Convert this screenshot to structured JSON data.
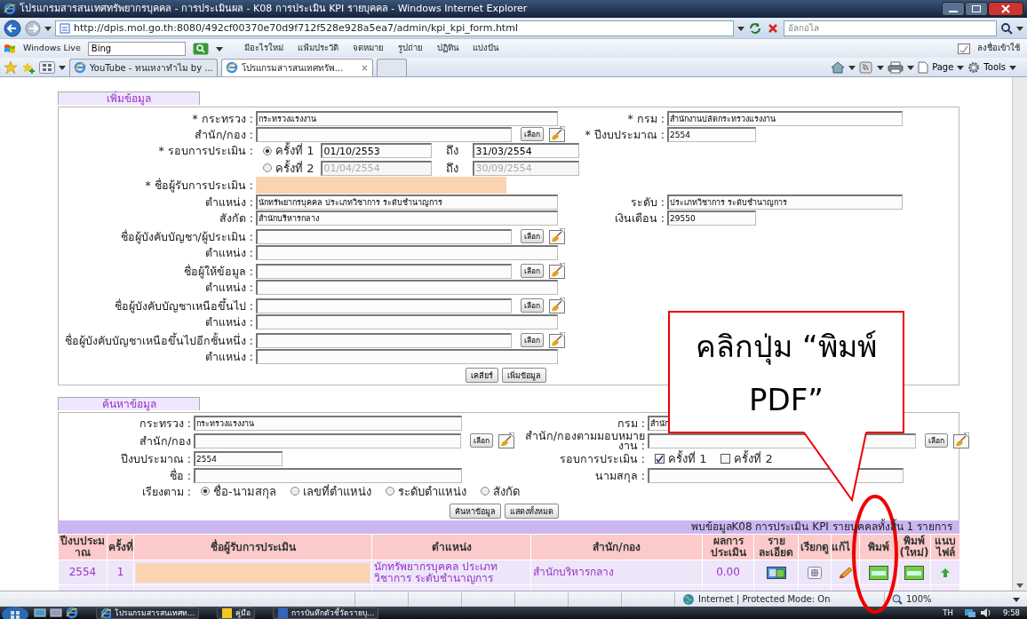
{
  "window": {
    "title": "โปรแกรมสารสนเทศทรัพยากรบุคคล - การประเมินผล - K08 การประเมิน KPI รายบุคคล - Windows Internet Explorer"
  },
  "address_bar": {
    "url": "http://dpis.mol.go.th:8080/492cf00370e70d9f712f528e928a5ea7/admin/kpi_kpi_form.html",
    "search_placeholder": "อัลกอไล"
  },
  "favorites_bar": {
    "brand": "Windows Live",
    "search_value": "Bing",
    "links": [
      "มีอะไรใหม่",
      "แฟ้มประวัติ",
      "จดหมาย",
      "รูปถ่าย",
      "ปฏิทิน",
      "แบ่งปัน"
    ],
    "sign_in": "ลงชื่อเข้าใช้"
  },
  "tabs": [
    {
      "label": "YouTube - ทนเหงาทำไม by ...",
      "selected": false
    },
    {
      "label": "โปรแกรมสารสนเทศทรัพ...",
      "selected": true,
      "close": "×"
    }
  ],
  "command_bar": {
    "page": "Page",
    "tools": "Tools"
  },
  "add_form": {
    "title": "เพิ่มข้อมูล",
    "rows": [
      {
        "left": {
          "kind": "field",
          "label": "* กระทรวง :",
          "value": "กระทรวงแรงงาน"
        },
        "right": {
          "kind": "field",
          "label": "* กรม :",
          "value": "สำนักงานปลัดกระทรวงแรงงาน"
        }
      },
      {
        "left": {
          "kind": "field",
          "label": "สำนัก/กอง :",
          "pick": "เลือก"
        },
        "right": {
          "kind": "short_field",
          "label": "* ปีงบประมาณ :",
          "value": "2554"
        }
      },
      {
        "left": {
          "kind": "round",
          "label": "* รอบการประเมิน :",
          "selected": true,
          "option": "ครั้งที่ 1",
          "from": "01/10/2553",
          "to_label": "ถึง",
          "to": "31/03/2554",
          "disabled": false
        }
      },
      {
        "left": {
          "kind": "round",
          "selected": false,
          "option": "ครั้งที่ 2",
          "from": "01/04/2554",
          "to_label": "ถึง",
          "to": "30/09/2554",
          "disabled": true
        }
      },
      {
        "left": {
          "kind": "masked_field",
          "label": "* ชื่อผู้รับการประเมิน :"
        }
      },
      {
        "left": {
          "kind": "field",
          "label": "ตำแหน่ง :",
          "value": "นักทรัพยากรบุคคล ประเภทวิชาการ ระดับชำนาญการ"
        },
        "right": {
          "kind": "field",
          "label": "ระดับ :",
          "value": "ประเภทวิชาการ ระดับชำนาญการ"
        }
      },
      {
        "left": {
          "kind": "field",
          "label": "สังกัด :",
          "value": "สำนักบริหารกลาง"
        },
        "right": {
          "kind": "short_field",
          "label": "เงินเดือน :",
          "value": "29550"
        }
      },
      {
        "left": {
          "kind": "field",
          "label": "ชื่อผู้บังคับบัญชา/ผู้ประเมิน :",
          "pick": "เลือก"
        }
      },
      {
        "left": {
          "kind": "field",
          "label": "ตำแหน่ง :"
        }
      },
      {
        "left": {
          "kind": "field",
          "label": "ชื่อผู้ให้ข้อมูล :",
          "pick": "เลือก"
        }
      },
      {
        "left": {
          "kind": "field",
          "label": "ตำแหน่ง :"
        }
      },
      {
        "left": {
          "kind": "field",
          "label": "ชื่อผู้บังคับบัญชาเหนือขึ้นไป :",
          "pick": "เลือก"
        }
      },
      {
        "left": {
          "kind": "field",
          "label": "ตำแหน่ง :"
        }
      },
      {
        "left": {
          "kind": "field",
          "label": "ชื่อผู้บังคับบัญชาเหนือขึ้นไปอีกชั้นหนึ่ง :",
          "pick": "เลือก"
        }
      },
      {
        "left": {
          "kind": "field",
          "label": "ตำแหน่ง :"
        }
      }
    ],
    "buttons": [
      "เคลียร์",
      "เพิ่มข้อมูล"
    ]
  },
  "search_form": {
    "title": "ค้นหาข้อมูล",
    "rows": [
      {
        "left": {
          "kind": "field",
          "label": "กระทรวง :",
          "value": "กระทรวงแรงงาน"
        },
        "right": {
          "kind": "field",
          "label": "กรม :",
          "value": "สำนัก"
        }
      },
      {
        "left": {
          "kind": "field",
          "label": "สำนัก/กอง",
          "pick": "เลือก"
        },
        "right": {
          "kind": "field",
          "label": "สำนัก/กองตามมอบหมายงาน :",
          "pick": "เลือก"
        }
      },
      {
        "left": {
          "kind": "short_field",
          "label": "ปีงบประมาณ :",
          "value": "2554"
        },
        "right": {
          "kind": "checks",
          "label": "รอบการประเมิน :",
          "options": [
            {
              "label": "ครั้งที่ 1",
              "checked": true
            },
            {
              "label": "ครั้งที่ 2",
              "checked": false
            }
          ]
        }
      },
      {
        "left": {
          "kind": "field",
          "label": "ชื่อ :"
        },
        "right": {
          "kind": "field",
          "label": "นามสกุล :"
        }
      },
      {
        "left": {
          "kind": "radios",
          "label": "เรียงตาม :",
          "options": [
            {
              "label": "ชื่อ-นามสกุล",
              "selected": true
            },
            {
              "label": "เลขที่ตำแหน่ง",
              "selected": false
            },
            {
              "label": "ระดับตำแหน่ง",
              "selected": false
            },
            {
              "label": "สังกัด",
              "selected": false
            }
          ]
        }
      }
    ],
    "buttons": [
      "ค้นหาข้อมูล",
      "แสดงทั้งหมด"
    ]
  },
  "results": {
    "summary": "พบข้อมูลK08 การประเมิน KPI รายบุคคลทั้งสิ้น 1 รายการ",
    "columns": [
      "ปีงบประมาณ",
      "ครั้งที่",
      "ชื่อผู้รับการประเมิน",
      "ตำแหน่ง",
      "สำนัก/กอง",
      "ผลการประเมิน",
      "รายละเอียด",
      "เรียกดู",
      "แก้ไ",
      "พิมพ์",
      "พิมพ์ (ใหม่)",
      "แนบไฟล์"
    ],
    "rows": [
      {
        "cells": [
          {
            "kind": "text",
            "text": "2554"
          },
          {
            "kind": "text",
            "text": "1"
          },
          {
            "kind": "masked"
          },
          {
            "kind": "text",
            "text": "นักทรัพยากรบุคคล ประเภทวิชาการ ระดับชำนาญการ"
          },
          {
            "kind": "text",
            "text": "สำนักบริหารกลาง"
          },
          {
            "kind": "text",
            "text": "0.00"
          },
          {
            "kind": "details"
          },
          {
            "kind": "view"
          },
          {
            "kind": "edit"
          },
          {
            "kind": "print"
          },
          {
            "kind": "print"
          },
          {
            "kind": "attach"
          }
        ]
      }
    ]
  },
  "callout": {
    "text": "คลิกปุ่ม “พิมพ์ PDF”",
    "highlight": true
  },
  "status_bar": {
    "zone": "Internet | Protected Mode: On",
    "zoom": "100%"
  },
  "taskbar": {
    "tasks": [
      "โปรแกรมสารสนเทศท...",
      "คู่มือ",
      "การบันทึกตัวชี้วัดรายบุ..."
    ],
    "language": "TH",
    "time": "9:58"
  }
}
